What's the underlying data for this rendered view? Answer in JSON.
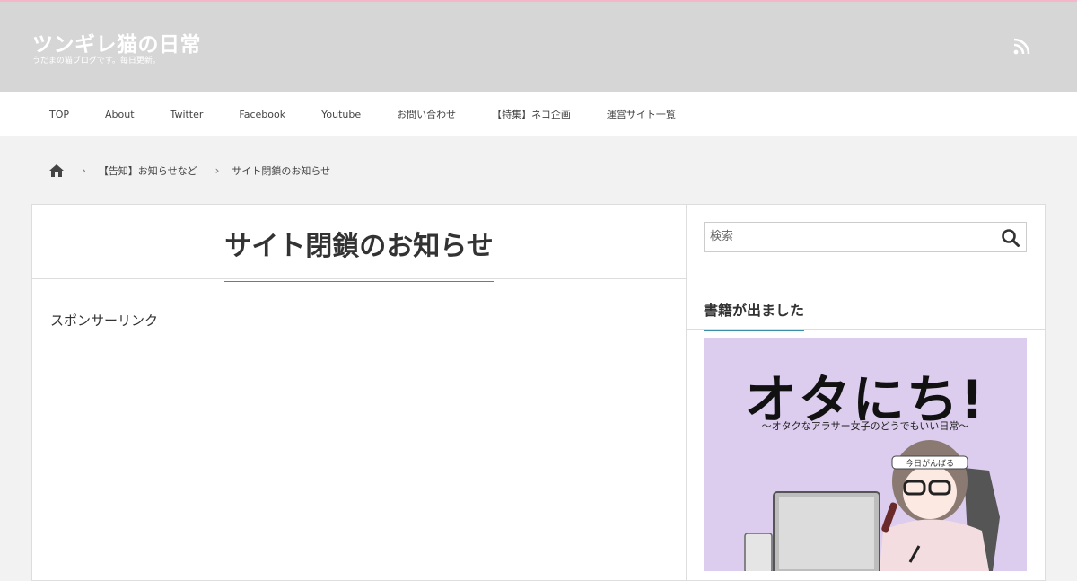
{
  "header": {
    "site_title": "ツンギレ猫の日常",
    "site_desc": "うだまの猫ブログです。毎日更新。"
  },
  "nav": [
    "TOP",
    "About",
    "Twitter",
    "Facebook",
    "Youtube",
    "お問い合わせ",
    "【特集】ネコ企画",
    "運営サイト一覧"
  ],
  "breadcrumb": {
    "category": "【告知】お知らせなど",
    "current": "サイト閉鎖のお知らせ"
  },
  "post": {
    "title": "サイト閉鎖のお知らせ",
    "sponsor": "スポンサーリンク"
  },
  "sidebar": {
    "search_placeholder": "検索",
    "widget_title": "書籍が出ました",
    "book": {
      "title": "オタにち!",
      "subtitle": "〜オタクなアラサー女子のどうでもいい日常〜",
      "headband": "今日がんばる"
    }
  },
  "colors": {
    "header_bg": "#d6d6d6",
    "accent_line": "#3a8fa8",
    "top_line": "#f4b6c8",
    "book_bg": "#dcccee"
  }
}
